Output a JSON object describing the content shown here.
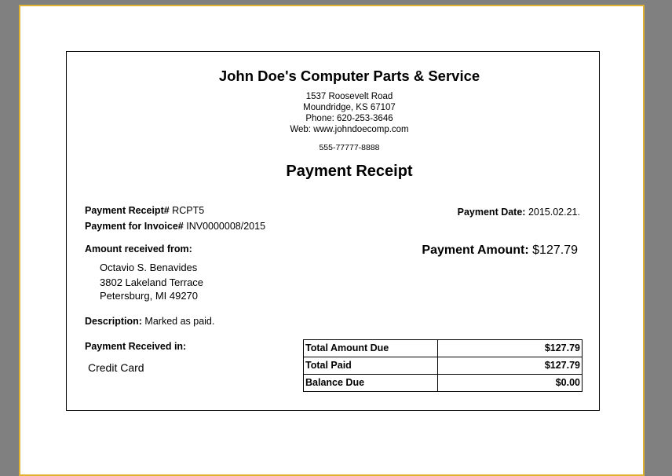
{
  "company": {
    "name": "John Doe's Computer Parts & Service",
    "address1": "1537 Roosevelt Road",
    "address2": "Moundridge, KS 67107",
    "phone": "Phone: 620-253-3646",
    "web": "Web: www.johndoecomp.com",
    "extra": "555-77777-8888"
  },
  "receipt": {
    "title": "Payment Receipt",
    "number_label": "Payment Receipt#",
    "number": "RCPT5",
    "invoice_label": "Payment for Invoice#",
    "invoice": "INV0000008/2015",
    "date_label": "Payment Date:",
    "date": "2015.02.21.",
    "amount_label": "Payment Amount:",
    "amount": "$127.79",
    "received_from_label": "Amount received from:",
    "customer": {
      "name": "Octavio S. Benavides",
      "street": "3802 Lakeland Terrace",
      "city": "Petersburg,  MI 49270"
    },
    "description_label": "Description:",
    "description": "Marked as paid.",
    "received_in_label": "Payment Received in:",
    "method": "Credit Card"
  },
  "totals": [
    {
      "label": "Total Amount Due",
      "value": "$127.79"
    },
    {
      "label": "Total Paid",
      "value": "$127.79"
    },
    {
      "label": "Balance Due",
      "value": "$0.00"
    }
  ],
  "colors": {
    "background": "#808080",
    "page_border": "#e0b030"
  }
}
